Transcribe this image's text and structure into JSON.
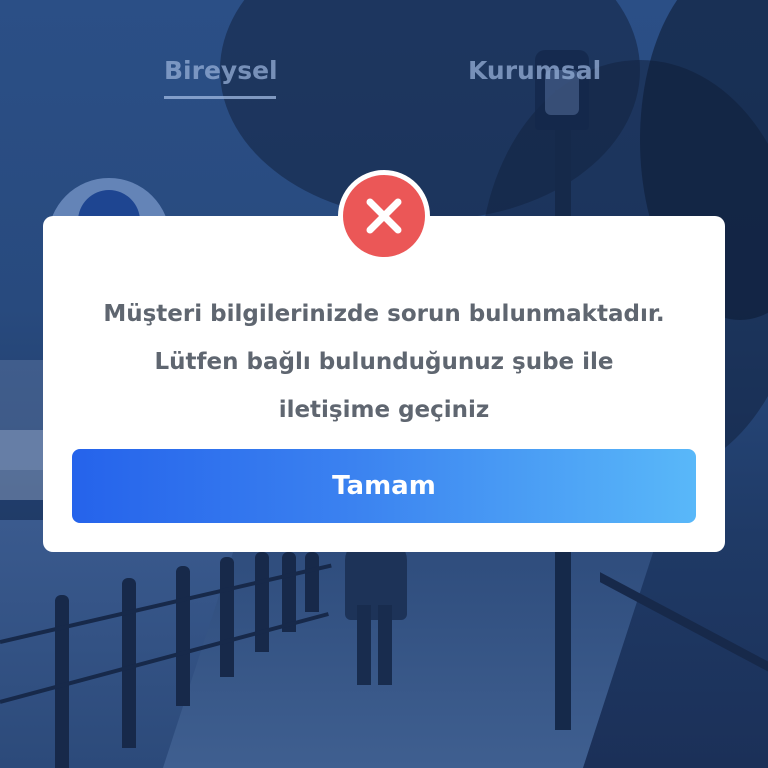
{
  "tabs": {
    "individual_label": "Bireysel",
    "corporate_label": "Kurumsal"
  },
  "dialog": {
    "icon": "close-x-icon",
    "message": "Müşteri bilgilerinizde sorun bulunmaktadır. Lütfen bağlı bulunduğunuz şube ile iletişime geçiniz",
    "button_label": "Tamam"
  },
  "colors": {
    "error_red": "#eb5757",
    "button_start": "#2563eb",
    "button_end": "#59b8f9",
    "message_text": "#5f6670",
    "background_overlay": "#2b4f86"
  }
}
